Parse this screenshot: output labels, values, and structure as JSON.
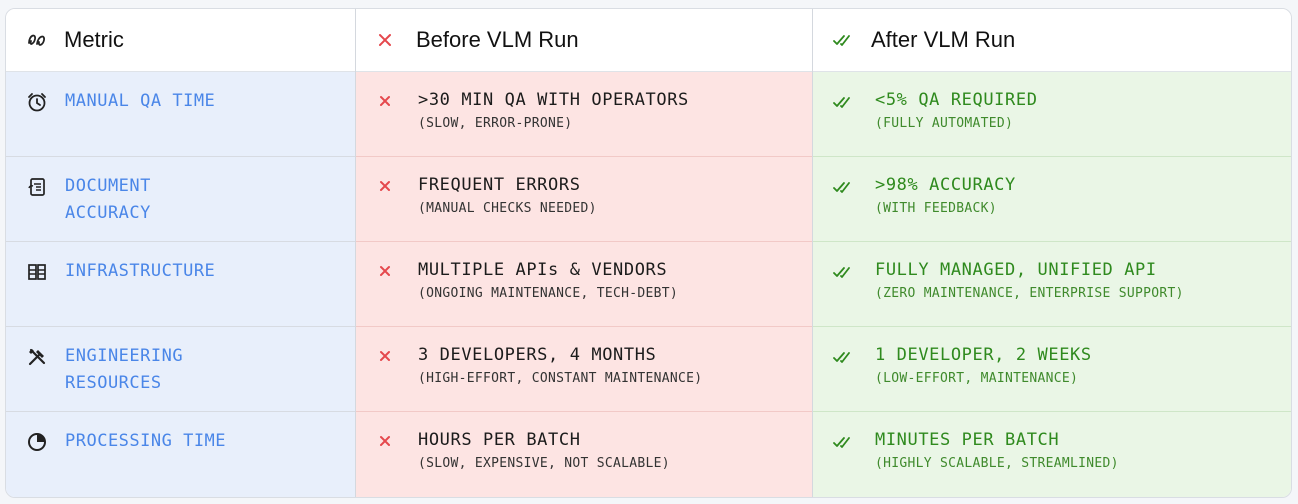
{
  "headers": {
    "metric": "Metric",
    "before": "Before VLM Run",
    "after": "After VLM Run"
  },
  "icons": {
    "metric_header": "metric-scribble-icon",
    "before_header": "x-icon",
    "after_header": "double-check-icon"
  },
  "colors": {
    "metric_text": "#4a86e8",
    "before_bg": "#fde4e3",
    "after_bg": "#eaf6e6",
    "metric_bg": "#e8effb",
    "x_mark": "#e5484d",
    "check_mark": "#2f8a1e"
  },
  "rows": [
    {
      "icon": "alarm-clock-icon",
      "metric": "MANUAL QA TIME",
      "before_main": ">30 MIN QA WITH OPERATORS",
      "before_sub": "(SLOW, ERROR-PRONE)",
      "after_main": "<5% QA REQUIRED",
      "after_sub": "(FULLY AUTOMATED)"
    },
    {
      "icon": "document-refresh-icon",
      "metric": "DOCUMENT\nACCURACY",
      "before_main": "FREQUENT ERRORS",
      "before_sub": "(MANUAL CHECKS NEEDED)",
      "after_main": ">98% ACCURACY",
      "after_sub": "(WITH FEEDBACK)"
    },
    {
      "icon": "server-rack-icon",
      "metric": "INFRASTRUCTURE",
      "before_main": "MULTIPLE APIs & VENDORS",
      "before_sub": "(ONGOING MAINTENANCE, TECH-DEBT)",
      "after_main": "FULLY MANAGED, UNIFIED API",
      "after_sub": "(ZERO MAINTENANCE, ENTERPRISE SUPPORT)"
    },
    {
      "icon": "tools-icon",
      "metric": "ENGINEERING\nRESOURCES",
      "before_main": "3 DEVELOPERS, 4 MONTHS",
      "before_sub": "(HIGH-EFFORT, CONSTANT MAINTENANCE)",
      "after_main": "1 DEVELOPER, 2 WEEKS",
      "after_sub": "(LOW-EFFORT, MAINTENANCE)"
    },
    {
      "icon": "pie-chart-icon",
      "metric": "PROCESSING TIME",
      "before_main": "HOURS PER BATCH",
      "before_sub": "(SLOW, EXPENSIVE, NOT SCALABLE)",
      "after_main": "MINUTES PER BATCH",
      "after_sub": "(HIGHLY SCALABLE, STREAMLINED)"
    }
  ]
}
